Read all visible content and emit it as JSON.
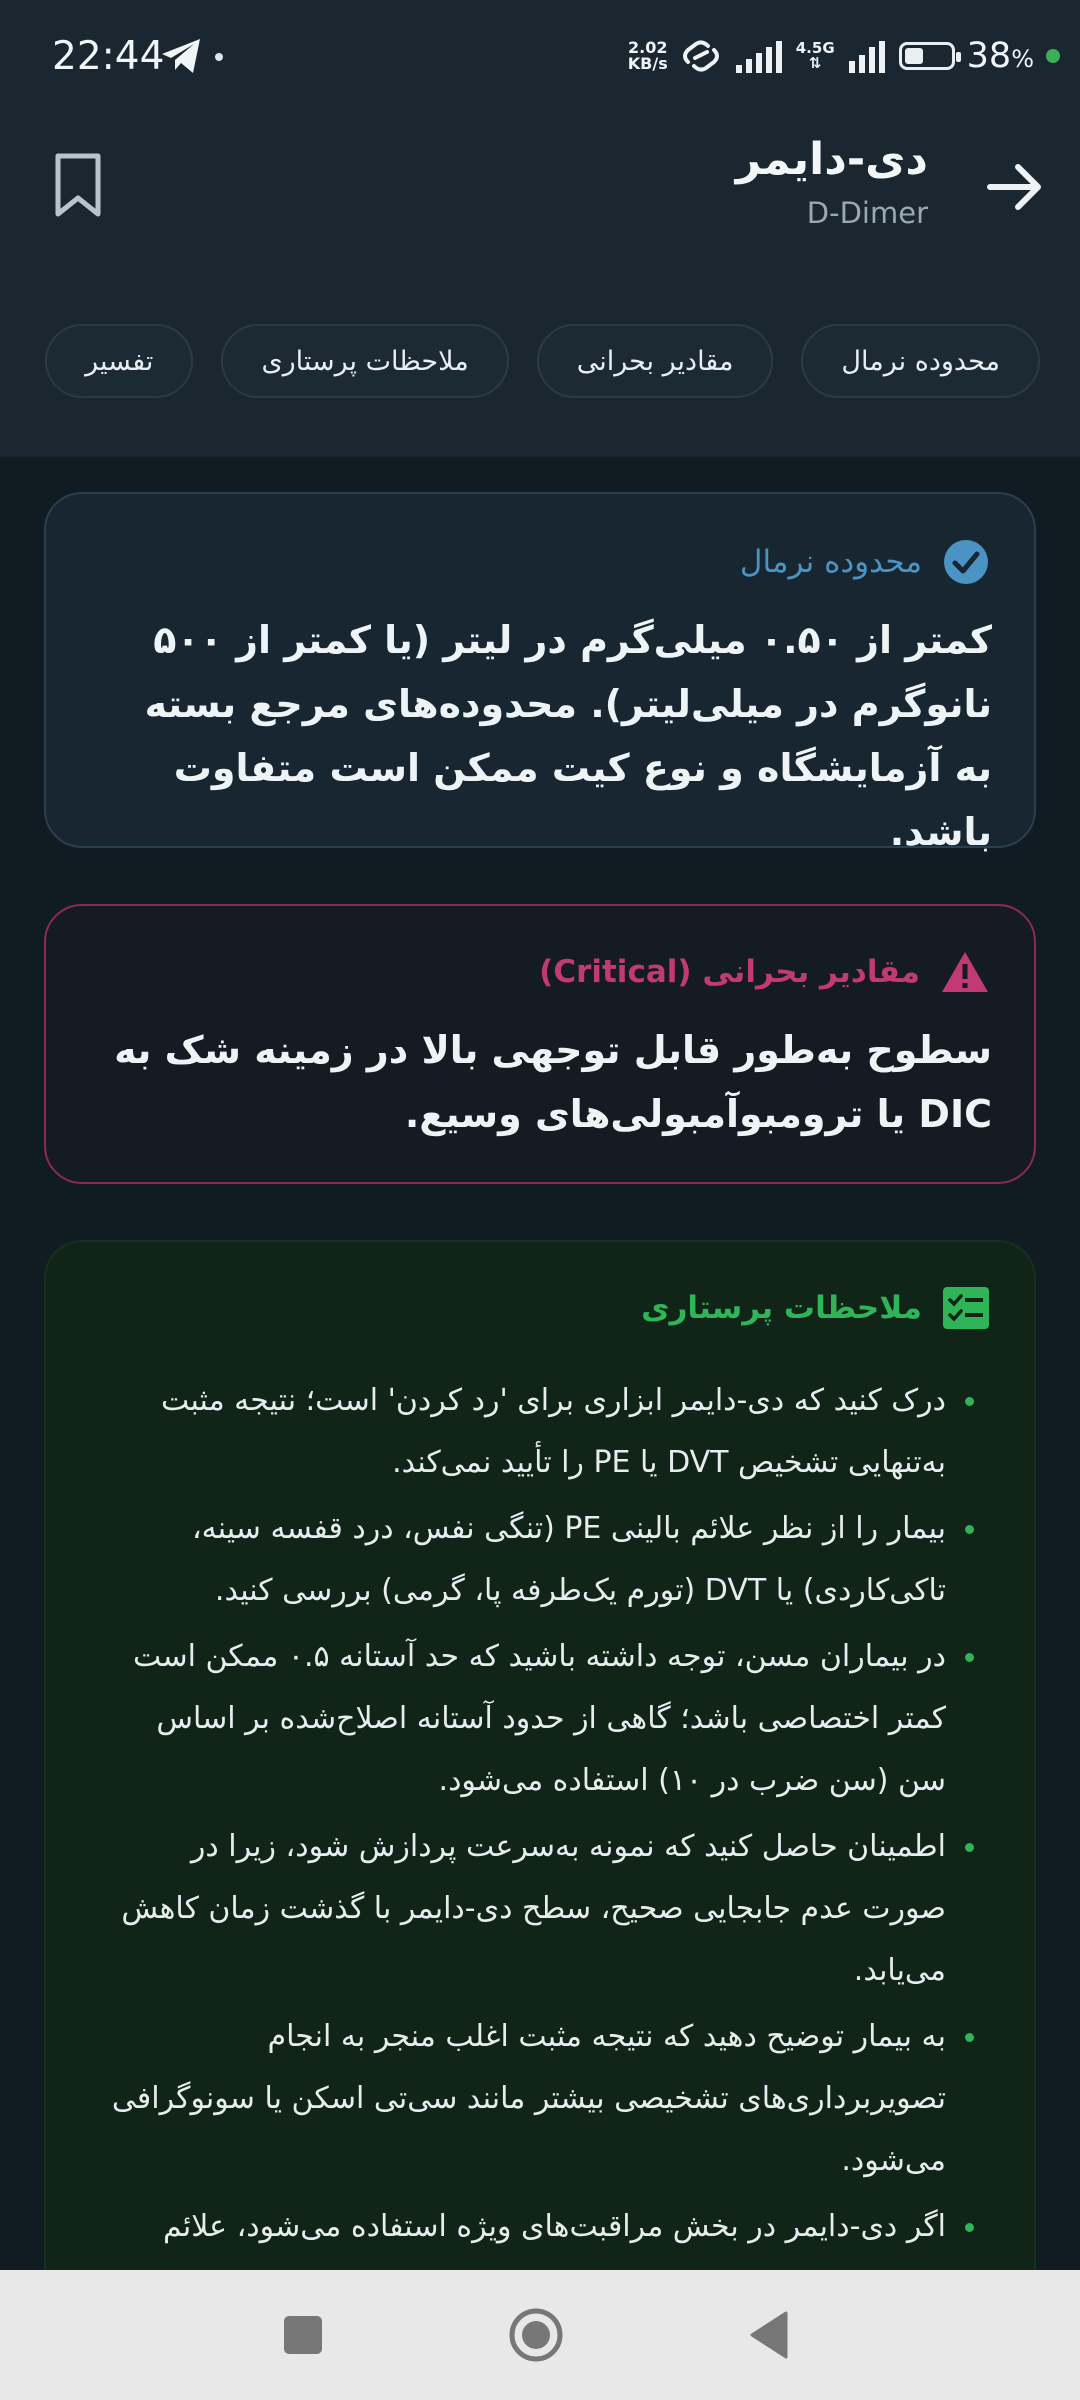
{
  "status_bar": {
    "time": "22:44",
    "speed_value": "2.02",
    "speed_unit": "KB/s",
    "network": "4.5G",
    "battery": "38",
    "battery_unit": "%",
    "icons": [
      "telegram-send-icon",
      "hotspot-link-icon",
      "signal-icon",
      "battery-icon"
    ]
  },
  "header": {
    "title": "دی-دایمر",
    "subtitle": "D-Dimer",
    "back_icon": "arrow-right-icon",
    "bookmark_icon": "bookmark-icon"
  },
  "tabs": [
    {
      "label": "محدوده نرمال"
    },
    {
      "label": "مقادیر بحرانی"
    },
    {
      "label": "ملاحظات پرستاری"
    },
    {
      "label": "تفسیر"
    }
  ],
  "normal": {
    "title": "محدوده نرمال",
    "icon": "check-circle-icon",
    "text": "کمتر از ۰.۵۰ میلی‌گرم در لیتر (یا کمتر از ۵۰۰ نانوگرم در میلی‌لیتر). محدوده‌های مرجع بسته به آزمایشگاه و نوع کیت ممکن است متفاوت باشد."
  },
  "critical": {
    "title": "مقادیر بحرانی (Critical)",
    "icon": "warning-triangle-icon",
    "text": "سطوح به‌طور قابل توجهی بالا در زمینه شک به DIC یا ترومبوآمبولی‌های وسیع."
  },
  "nursing": {
    "title": "ملاحظات پرستاری",
    "icon": "checklist-icon",
    "items": [
      "درک کنید که دی-دایمر ابزاری برای 'رد کردن' است؛ نتیجه مثبت به‌تنهایی تشخیص DVT یا PE را تأیید نمی‌کند.",
      "بیمار را از نظر علائم بالینی PE (تنگی نفس، درد قفسه سینه، تاکی‌کاردی) یا DVT (تورم یک‌طرفه پا، گرمی) بررسی کنید.",
      "در بیماران مسن، توجه داشته باشید که حد آستانه ۰.۵ ممکن است کمتر اختصاصی باشد؛ گاهی از حدود آستانه اصلاح‌شده بر اساس سن (سن ضرب در ۱۰) استفاده می‌شود.",
      "اطمینان حاصل کنید که نمونه به‌سرعت پردازش شود، زیرا در صورت عدم جابجایی صحیح، سطح دی-دایمر با گذشت زمان کاهش می‌یابد.",
      "به بیمار توضیح دهید که نتیجه مثبت اغلب منجر به انجام تصویربرداری‌های تشخیصی بیشتر مانند سی‌تی اسکن یا سونوگرافی می‌شود.",
      "اگر دی-دایمر در بخش مراقبت‌های ویژه استفاده می‌شود، علائم DIC (خونریزی از چندین محل، پتشی) را پایش کنید."
    ]
  },
  "nav": {
    "icons": [
      "recents-square-icon",
      "home-circle-icon",
      "back-triangle-icon"
    ]
  },
  "colors": {
    "background": "#111b22",
    "header": "#1a2731",
    "normal_accent": "#4b93c2",
    "critical_accent": "#c23a73",
    "nursing_accent": "#2fb457"
  }
}
